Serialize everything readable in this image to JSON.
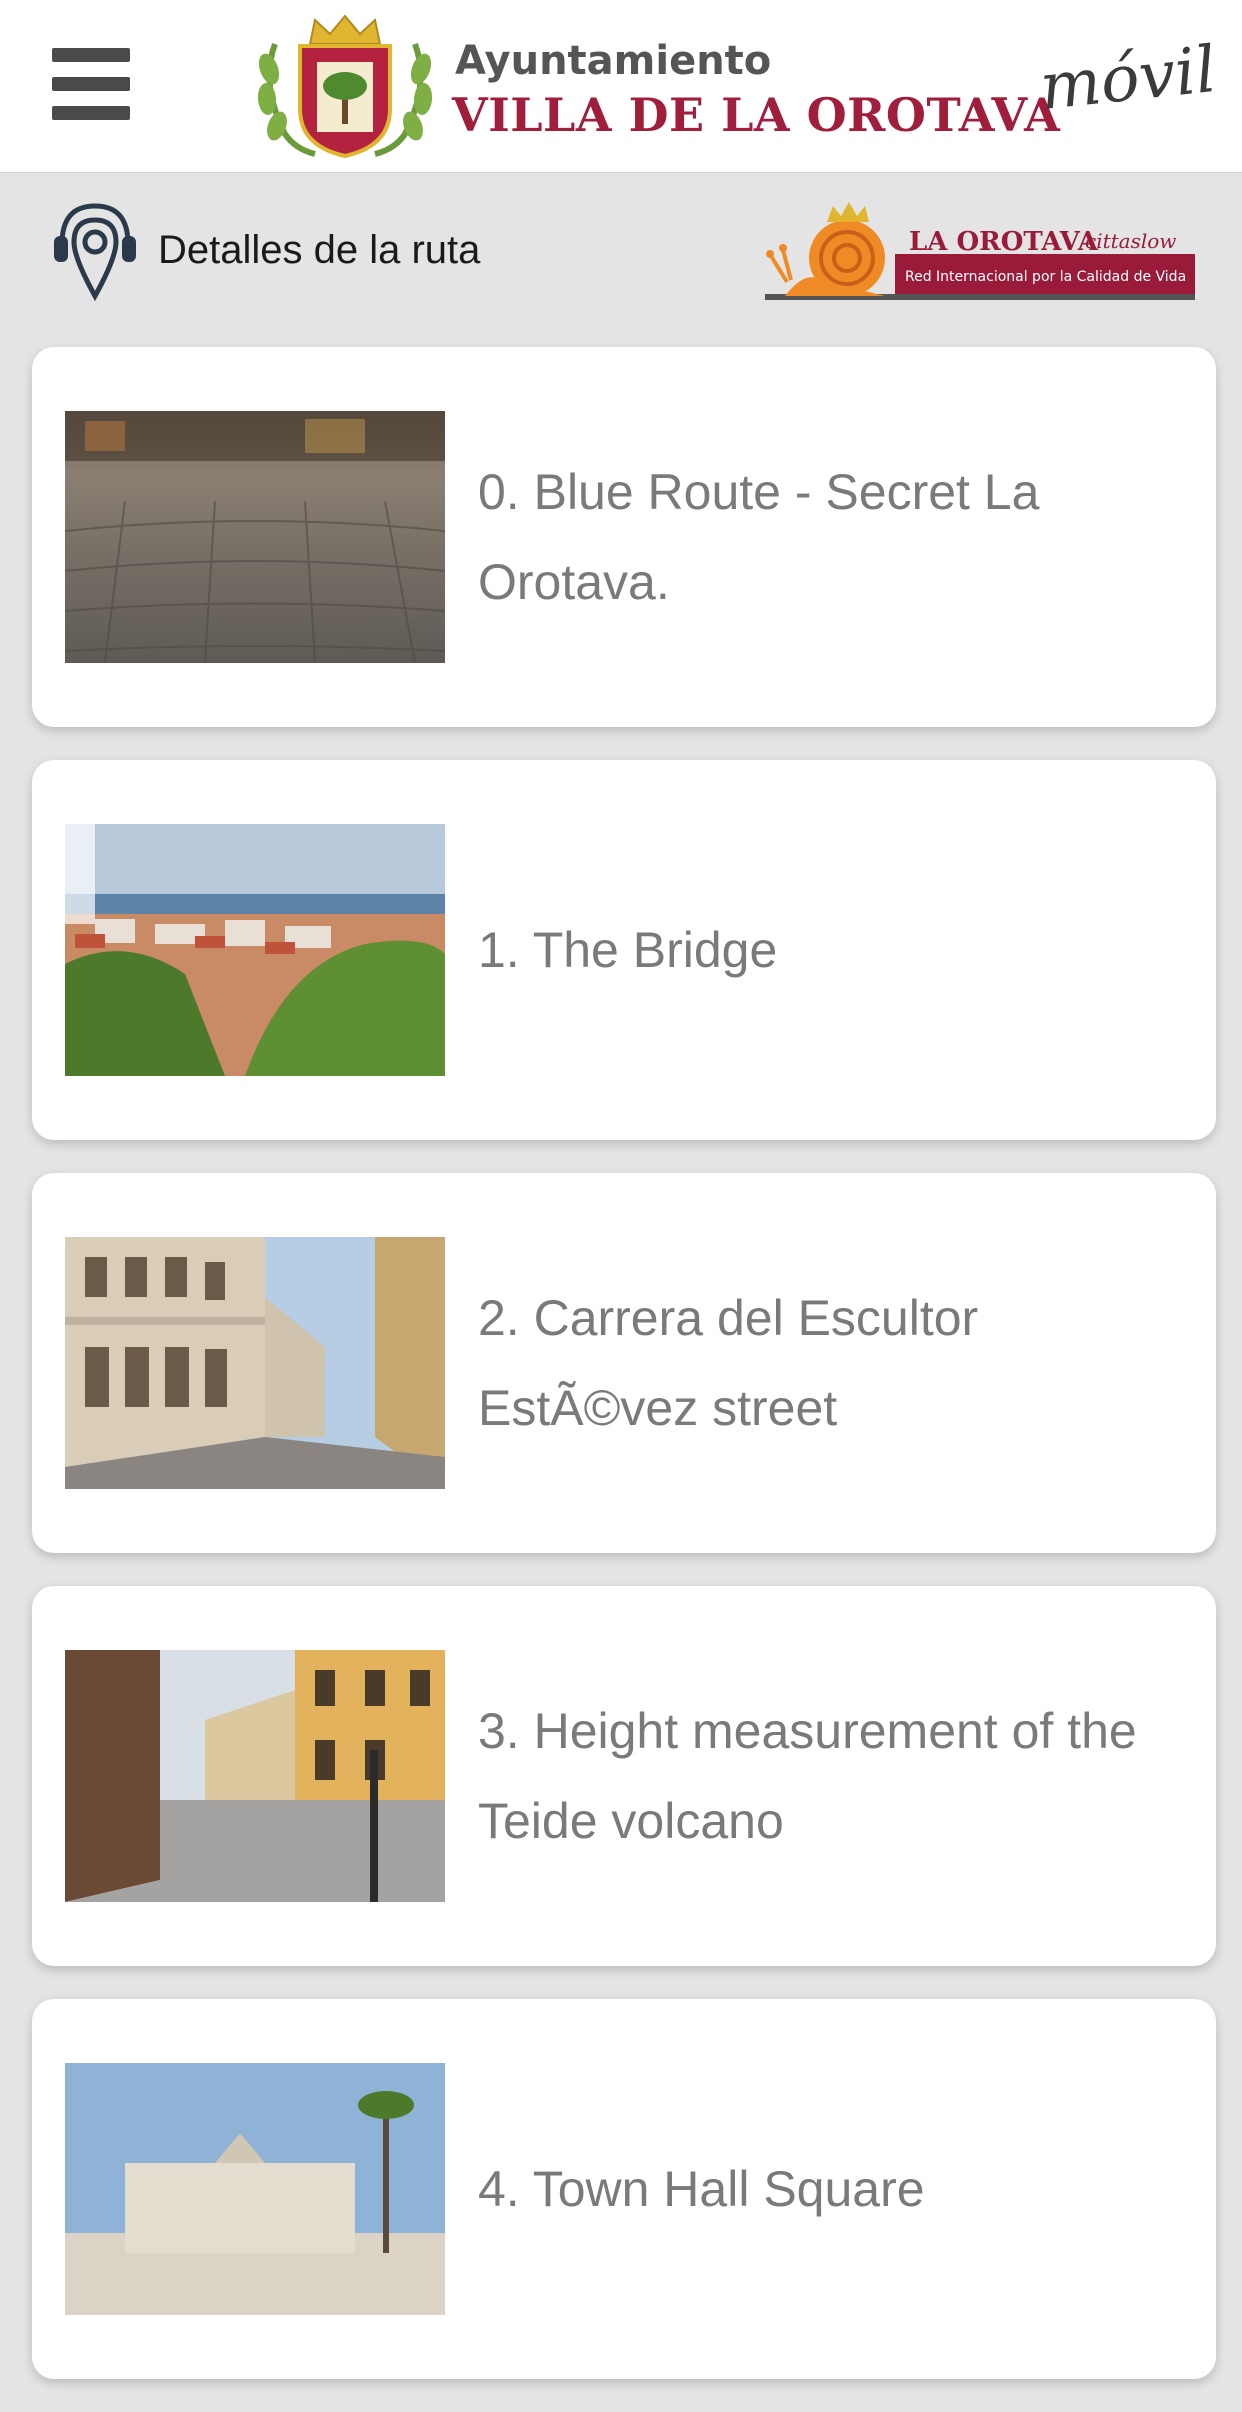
{
  "header": {
    "brand_line1": "Ayuntamiento",
    "brand_line2": "VILLA DE LA OROTAVA",
    "brand_suffix": "móvil",
    "menu_icon": "hamburger-menu-icon",
    "logo_icon": "coat-of-arms-logo"
  },
  "subbar": {
    "title": "Detalles de la ruta",
    "icon": "audio-guide-location-icon",
    "badge": {
      "title": "LA OROTAVA",
      "subtitle": "Red Internacional por la Calidad de Vida",
      "script": "cittaslow"
    }
  },
  "routes": [
    {
      "title": "0. Blue Route - Secret La Orotava.",
      "thumbnail": "cobblestone-street-photo"
    },
    {
      "title": "1. The Bridge",
      "thumbnail": "town-view-ocean-photo"
    },
    {
      "title": "2. Carrera del Escultor EstÃ©vez street",
      "thumbnail": "historic-street-buildings-photo"
    },
    {
      "title": "3. Height measurement of the Teide volcano",
      "thumbnail": "wet-street-yellow-buildings-photo"
    },
    {
      "title": "4. Town Hall Square",
      "thumbnail": "town-hall-square-photo"
    }
  ],
  "colors": {
    "brand_red": "#a01d3c",
    "snail_orange": "#f08a24",
    "card_text": "#7a7a7a",
    "background": "#e4e4e4"
  }
}
